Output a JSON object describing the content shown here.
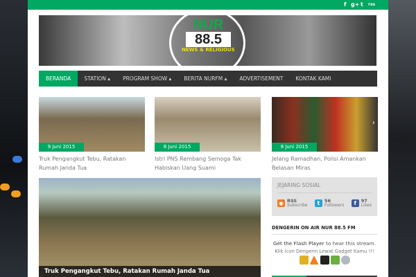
{
  "topbar": {
    "social": [
      "f",
      "g+",
      "t",
      "rss"
    ]
  },
  "logo": {
    "brand": "NUR",
    "frequency": "88.5",
    "tagline": "NEWS & RELIGIOUS"
  },
  "nav": [
    {
      "label": "BERANDA"
    },
    {
      "label": "STATION ▴"
    },
    {
      "label": "PROGRAM SHOW ▴"
    },
    {
      "label": "BERITA NURFM ▴"
    },
    {
      "label": "ADVERTISEMENT"
    },
    {
      "label": "KONTAK KAMI"
    }
  ],
  "cards": [
    {
      "date": "9 Juni 2015",
      "title": "Truk Pengangkut Tebu, Ratakan Rumah Janda Tua"
    },
    {
      "date": "8 Juni 2015",
      "title": "Istri PNS Rembang Semoga Tak Habiskan Uang Suami"
    },
    {
      "date": "8 Juni 2015",
      "title": "Jelang Ramadhan, Polisi Amankan Belasan Miras"
    }
  ],
  "carousel_next": "›",
  "featured": {
    "title": "Truk Pengangkut Tebu, Ratakan Rumah Janda Tua"
  },
  "sidebar": {
    "social_heading": "JEJARING SOSIAL",
    "social": [
      {
        "count": "RSS",
        "label": "Subscribe",
        "color": "#f07a20"
      },
      {
        "count": "56",
        "label": "Followers",
        "color": "#2aa0d8"
      },
      {
        "count": "97",
        "label": "Likes",
        "color": "#3b5998"
      }
    ],
    "stream_heading": "DENGERIN ON AIR NUR 88.5 FM",
    "flash_link": "Get the Flash Player",
    "flash_text": " to hear this stream.",
    "gadget_text": "Klik Icon Dengerin Lewat Gadget Kamu !!!"
  }
}
